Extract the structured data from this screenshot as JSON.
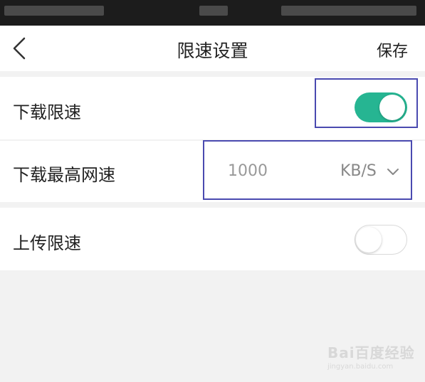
{
  "nav": {
    "title": "限速设置",
    "save_label": "保存"
  },
  "settings": {
    "download_limit": {
      "label": "下载限速",
      "enabled": true
    },
    "download_max_speed": {
      "label": "下载最高网速",
      "value": "1000",
      "unit": "KB/S"
    },
    "upload_limit": {
      "label": "上传限速",
      "enabled": false
    }
  },
  "colors": {
    "accent": "#26b592",
    "highlight_border": "#4a4ab0",
    "page_bg": "#f2f2f2"
  },
  "watermark": {
    "brand": "Bai百度经验",
    "url": "jingyan.baidu.com"
  }
}
